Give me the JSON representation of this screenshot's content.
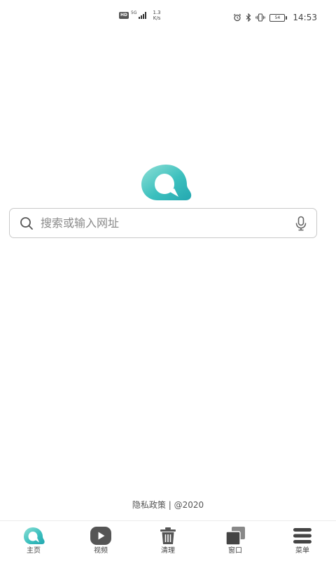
{
  "status_bar": {
    "hd_label": "HD",
    "network_gen": "5G",
    "net_speed_value": "1.3",
    "net_speed_unit": "K/s",
    "battery_level": "54",
    "time": "14:53",
    "icons": [
      "hd-icon",
      "signal-icon",
      "alarm-icon",
      "bluetooth-icon",
      "vibrate-icon",
      "battery-icon"
    ]
  },
  "brand": {
    "logo_icon": "browser-logo-icon",
    "accent_color": "#3cc0be"
  },
  "search": {
    "placeholder": "搜索或输入网址",
    "value": "",
    "left_icon": "search-icon",
    "right_icon": "microphone-icon"
  },
  "footer": {
    "text": "隐私政策 | @2020"
  },
  "bottom_nav": {
    "items": [
      {
        "label": "主页",
        "icon": "home-logo-icon",
        "active": true
      },
      {
        "label": "视频",
        "icon": "video-play-icon",
        "active": false
      },
      {
        "label": "清理",
        "icon": "trash-icon",
        "active": false
      },
      {
        "label": "窗口",
        "icon": "windows-icon",
        "active": false
      },
      {
        "label": "菜单",
        "icon": "menu-icon",
        "active": false
      }
    ]
  }
}
